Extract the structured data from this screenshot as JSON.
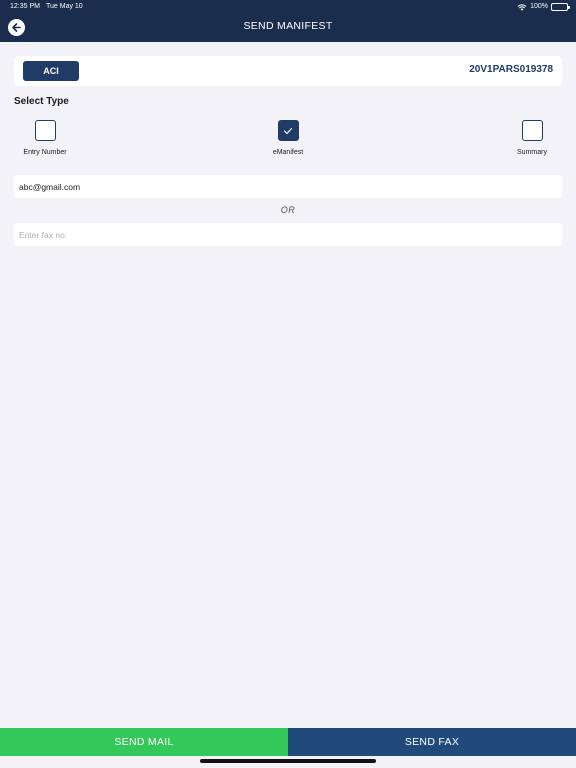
{
  "status_bar": {
    "time": "12:35 PM",
    "date": "Tue May 10",
    "battery": "100%",
    "battery_level": 1.0
  },
  "header": {
    "title": "SEND MANIFEST",
    "back_icon": "back-arrow-icon"
  },
  "info": {
    "badge": "ACI",
    "manifest_id": "20V1PARS019378"
  },
  "select_type": {
    "title": "Select Type",
    "options": [
      {
        "label": "Entry Number",
        "checked": false
      },
      {
        "label": "eManifest",
        "checked": true
      },
      {
        "label": "Summary",
        "checked": false
      }
    ]
  },
  "email": {
    "value": "abc@gmail.com"
  },
  "separator": "OR",
  "fax": {
    "value": "",
    "placeholder": "Enter fax no."
  },
  "actions": {
    "send_mail": "SEND MAIL",
    "send_fax": "SEND FAX"
  },
  "colors": {
    "navy": "#1a2d4d",
    "accent": "#1f3b66",
    "mail_green": "#34c759",
    "fax_blue": "#1f4a7a"
  }
}
